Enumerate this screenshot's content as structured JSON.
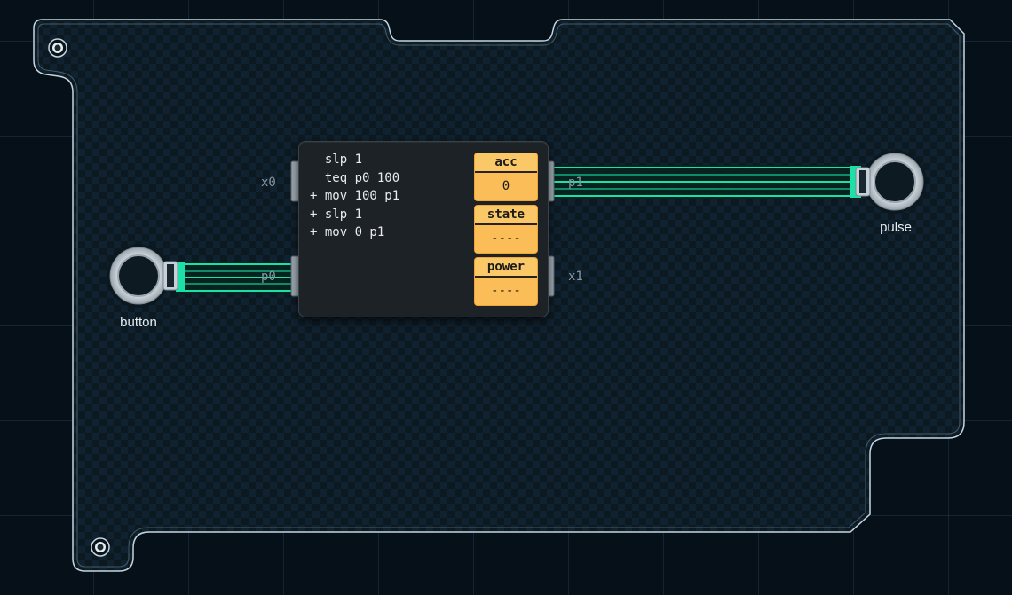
{
  "microcontroller": {
    "code": [
      "  slp 1",
      "  teq p0 100",
      "+ mov 100 p1",
      "+ slp 1",
      "+ mov 0 p1"
    ],
    "registers": [
      {
        "name": "acc",
        "value": "0"
      },
      {
        "name": "state",
        "value": "----"
      },
      {
        "name": "power",
        "value": "----"
      }
    ],
    "ports": {
      "x0": "x0",
      "p0": "p0",
      "p1": "p1",
      "x1": "x1"
    }
  },
  "components": {
    "input": {
      "label": "button"
    },
    "output": {
      "label": "pulse"
    }
  },
  "colors": {
    "wire": "#1de0a8",
    "register": "#f9b544",
    "board_outline": "#c6d6e0",
    "background": "#061018"
  }
}
